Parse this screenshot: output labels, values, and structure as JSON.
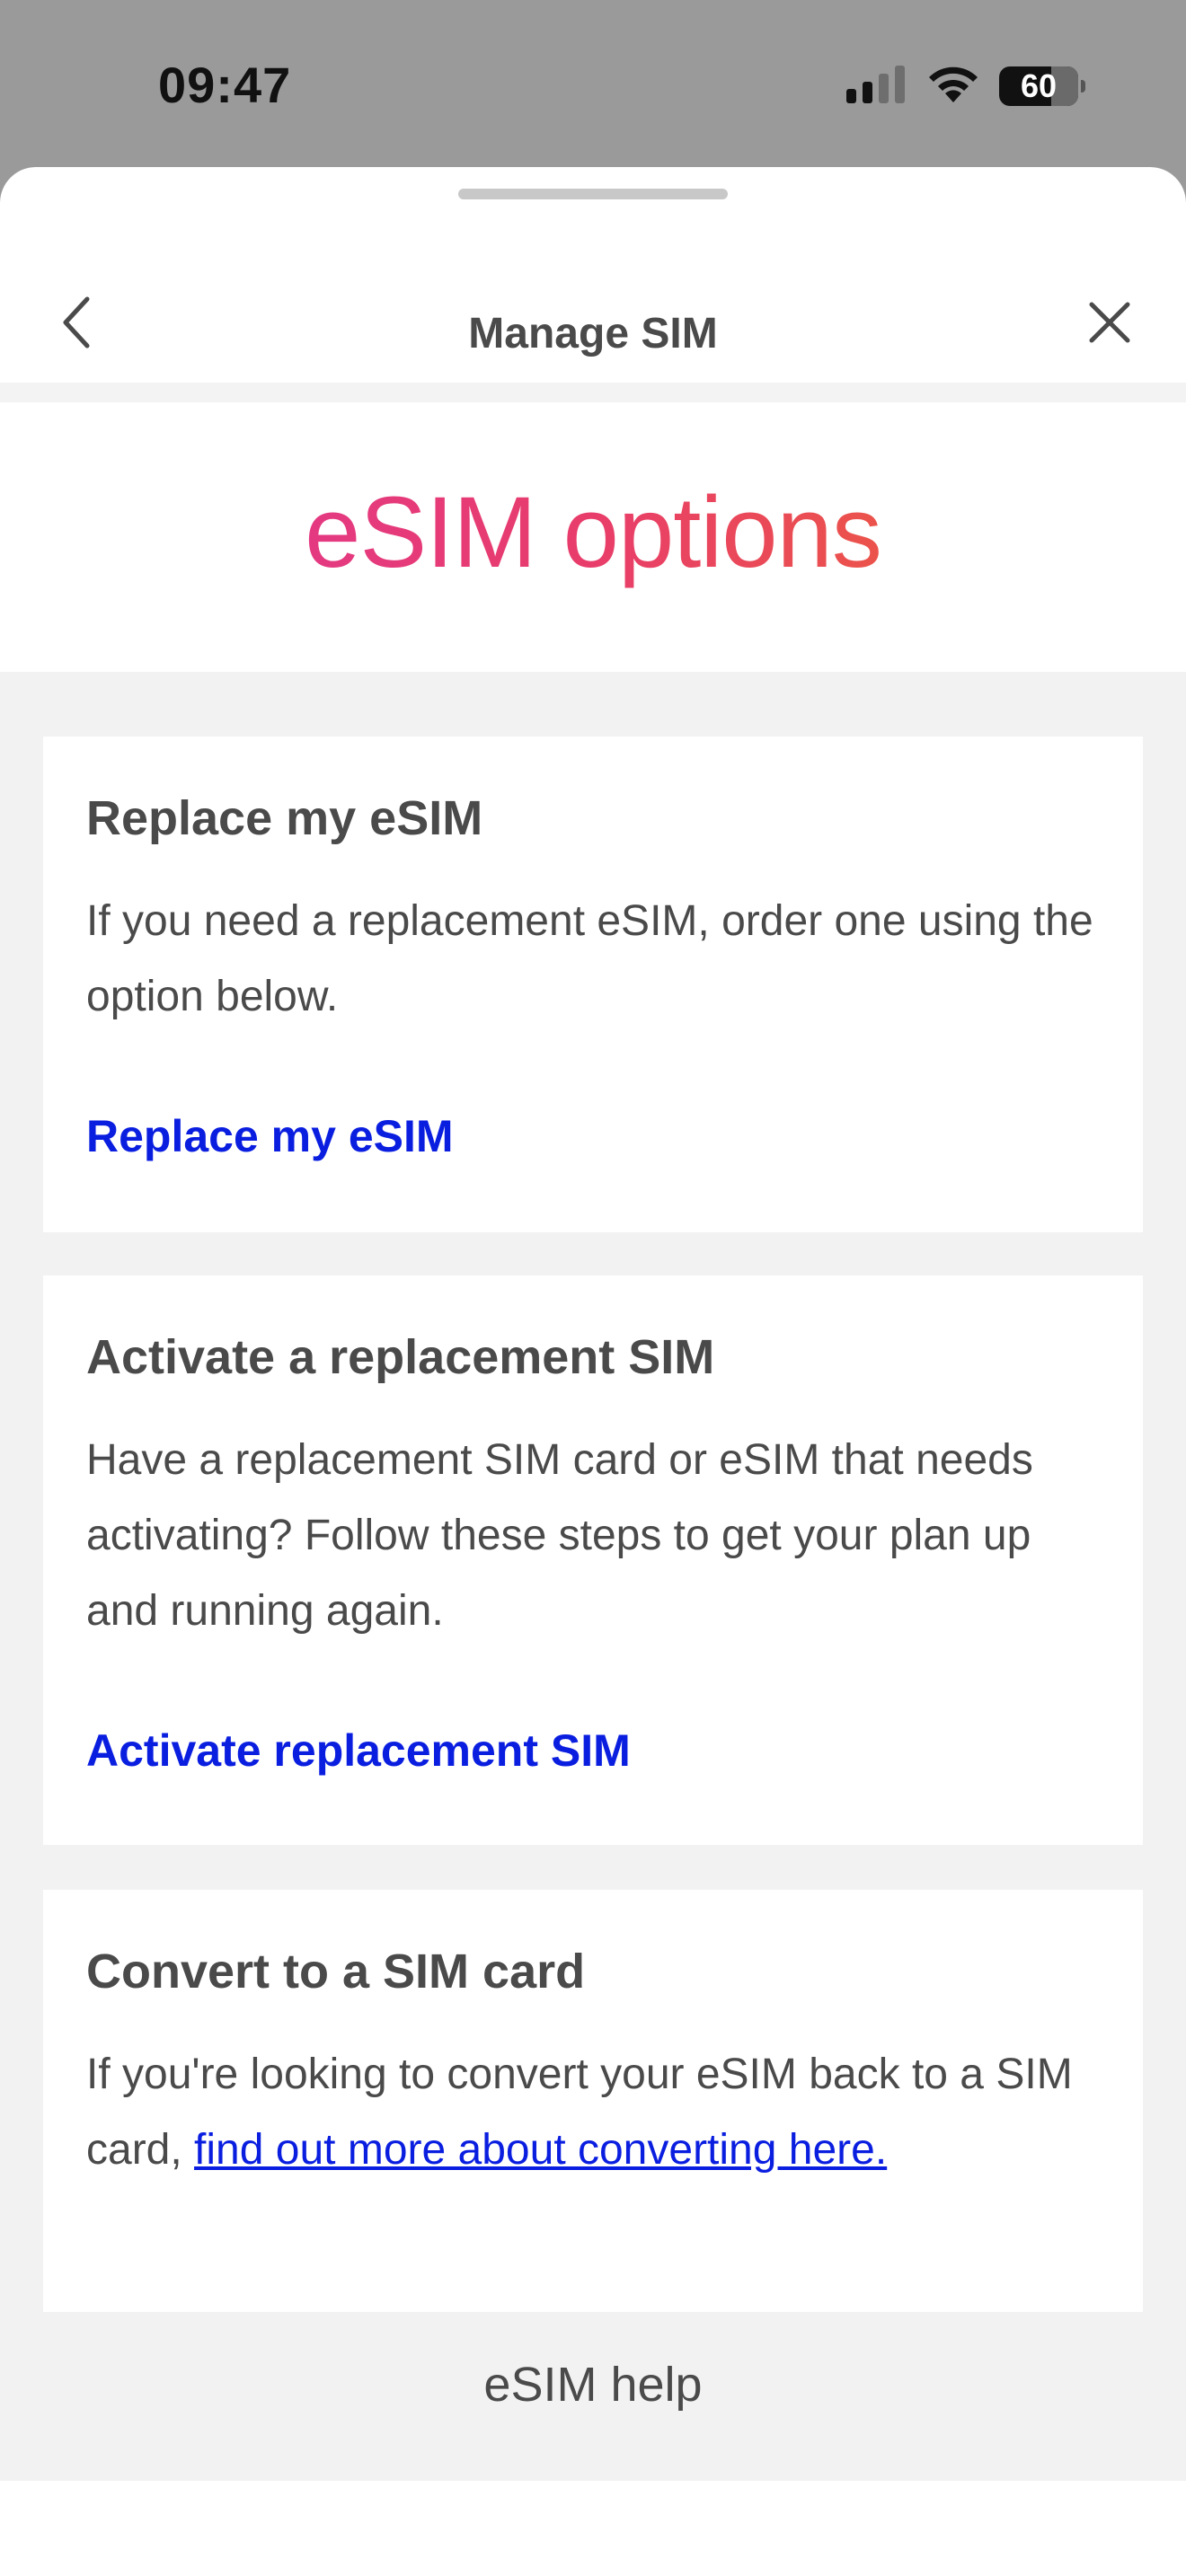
{
  "status_bar": {
    "time": "09:47",
    "battery": "60",
    "icons": [
      "cellular-signal-icon",
      "wifi-icon",
      "battery-icon"
    ]
  },
  "header": {
    "title": "Manage SIM",
    "back_icon": "chevron-left-icon",
    "close_icon": "close-icon"
  },
  "hero": {
    "title": "eSIM options"
  },
  "cards": [
    {
      "title": "Replace my eSIM",
      "body": "If you need a replacement eSIM, order one using the option below.",
      "action": "Replace my eSIM"
    },
    {
      "title": "Activate a replacement SIM",
      "body": "Have a replacement SIM card or eSIM that needs activating? Follow these steps to get your plan up and running again.",
      "action": "Activate replacement SIM"
    },
    {
      "title": "Convert to a SIM card",
      "body_prefix": "If you're looking to convert your eSIM back to a SIM card, ",
      "body_link": "find out more about converting here."
    }
  ],
  "footer": {
    "help_label": "eSIM help"
  },
  "colors": {
    "link": "#0a1ee0",
    "gradient_start": "#e0359b",
    "gradient_end": "#ef6a2a",
    "page_background": "#f2f2f2"
  }
}
